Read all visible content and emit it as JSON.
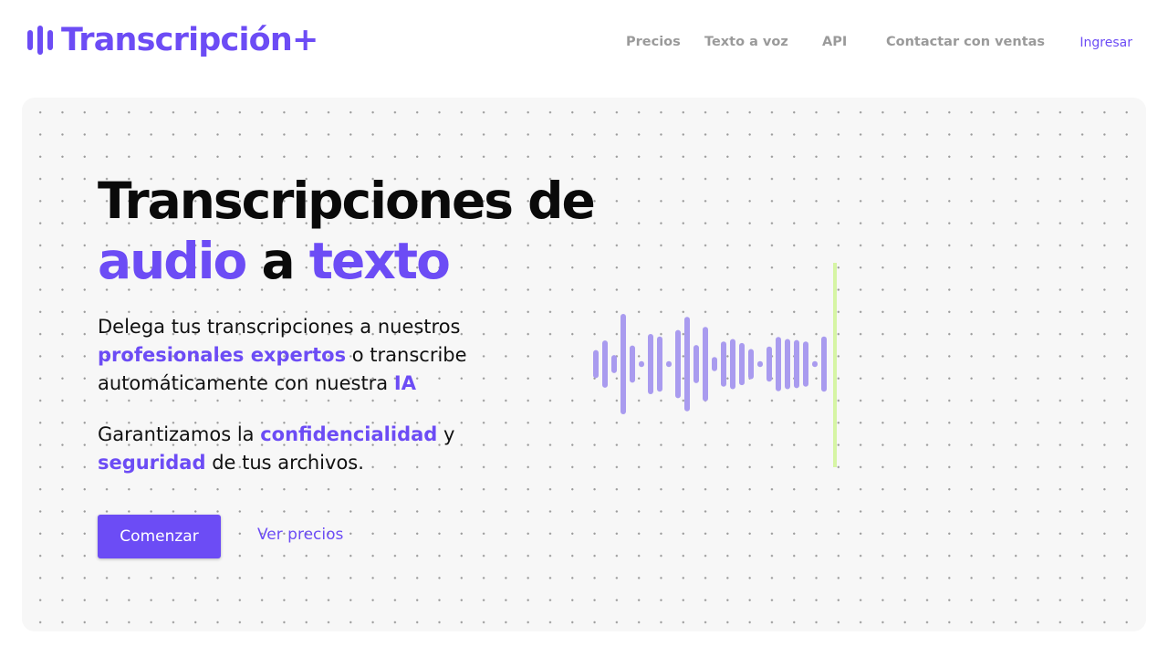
{
  "brand": {
    "name": "Transcripción+",
    "color": "#6c4cf5"
  },
  "nav": {
    "items": [
      "Precios",
      "Texto a voz",
      "API",
      "Contactar con ventas"
    ],
    "login": "Ingresar"
  },
  "hero": {
    "title_line1": "Transcripciones de",
    "title_audio": "audio",
    "title_a": "a",
    "title_texto": "texto",
    "p1": {
      "t1": "Delega tus transcripciones a nuestros",
      "a1": "profesionales expertos",
      "t2": "o transcribe",
      "t3": "automáticamente con nuestra",
      "a2": "IA"
    },
    "p2": {
      "t1": "Garantizamos la",
      "a1": "confidencialidad",
      "t2": "y",
      "a2": "seguridad",
      "t3": "de tus archivos."
    },
    "cta_primary": "Comenzar",
    "cta_secondary": "Ver precios"
  },
  "waveform": {
    "bar_color": "#a99bef",
    "playhead_color": "#d6f5a4",
    "levels": [
      0.28,
      0.47,
      0.18,
      1.0,
      0.37,
      0.06,
      0.6,
      0.55,
      0.06,
      0.68,
      0.94,
      0.38,
      0.74,
      0.14,
      0.45,
      0.5,
      0.42,
      0.3,
      0.06,
      0.35,
      0.54,
      0.5,
      0.48,
      0.45,
      0.06,
      0.55
    ]
  }
}
